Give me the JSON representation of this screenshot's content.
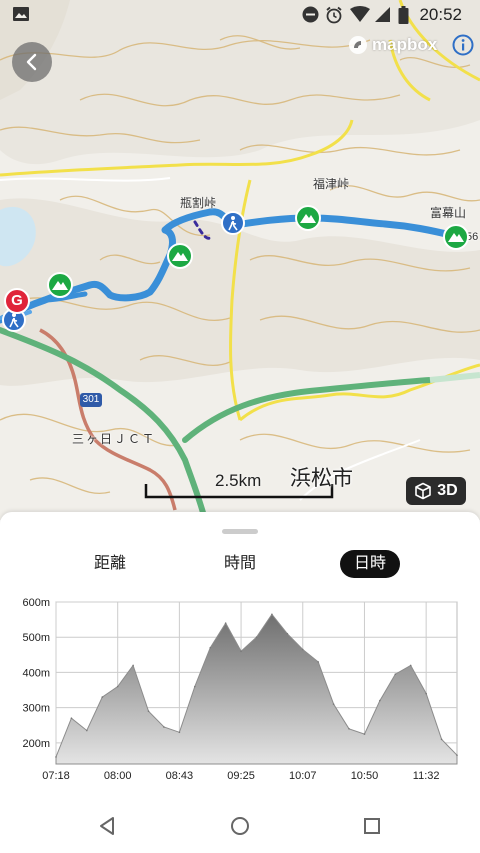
{
  "status_bar": {
    "time": "20:52",
    "icons": [
      "image-icon",
      "do-not-disturb-icon",
      "alarm-icon",
      "wifi-icon",
      "signal-icon",
      "battery-icon"
    ]
  },
  "map": {
    "attribution": "mapbox",
    "labels": {
      "pass_1": "瓶割峠",
      "pass_2": "福津峠",
      "mountain": "富幕山",
      "mountain_elev": "56",
      "junction": "三ヶ日ＪＣＴ",
      "route_number": "301",
      "city": "浜松市"
    },
    "scale_label": "2.5km",
    "view_toggle": "3D",
    "goal_marker": "G",
    "colors": {
      "track": "#3a8fd8",
      "expressway": "#5fb27a",
      "road_major": "#f2e04a",
      "road_minor": "#c97d6b",
      "contour": "#d8b87c",
      "summit": "#1ca843",
      "goal": "#e0243a"
    }
  },
  "sheet": {
    "tabs": [
      {
        "label": "距離",
        "active": false
      },
      {
        "label": "時間",
        "active": false
      },
      {
        "label": "日時",
        "active": true
      }
    ]
  },
  "chart_data": {
    "type": "area",
    "x": [
      "07:18",
      "07:30",
      "07:40",
      "07:50",
      "08:00",
      "08:10",
      "08:20",
      "08:30",
      "08:43",
      "08:55",
      "09:05",
      "09:15",
      "09:25",
      "09:35",
      "09:45",
      "09:55",
      "10:07",
      "10:20",
      "10:30",
      "10:40",
      "10:50",
      "11:00",
      "11:10",
      "11:20",
      "11:32",
      "11:45",
      "11:55"
    ],
    "y": [
      160,
      270,
      235,
      330,
      360,
      420,
      290,
      245,
      230,
      360,
      470,
      540,
      460,
      500,
      565,
      510,
      465,
      430,
      310,
      240,
      225,
      320,
      395,
      420,
      340,
      210,
      165
    ],
    "xticks": [
      "07:18",
      "08:00",
      "08:43",
      "09:25",
      "10:07",
      "10:50",
      "11:32"
    ],
    "yticks": [
      "200m",
      "300m",
      "400m",
      "500m",
      "600m"
    ],
    "ylim": [
      140,
      600
    ],
    "grid": true,
    "xlabel": "",
    "ylabel": "",
    "color": "#8c8c8c"
  }
}
